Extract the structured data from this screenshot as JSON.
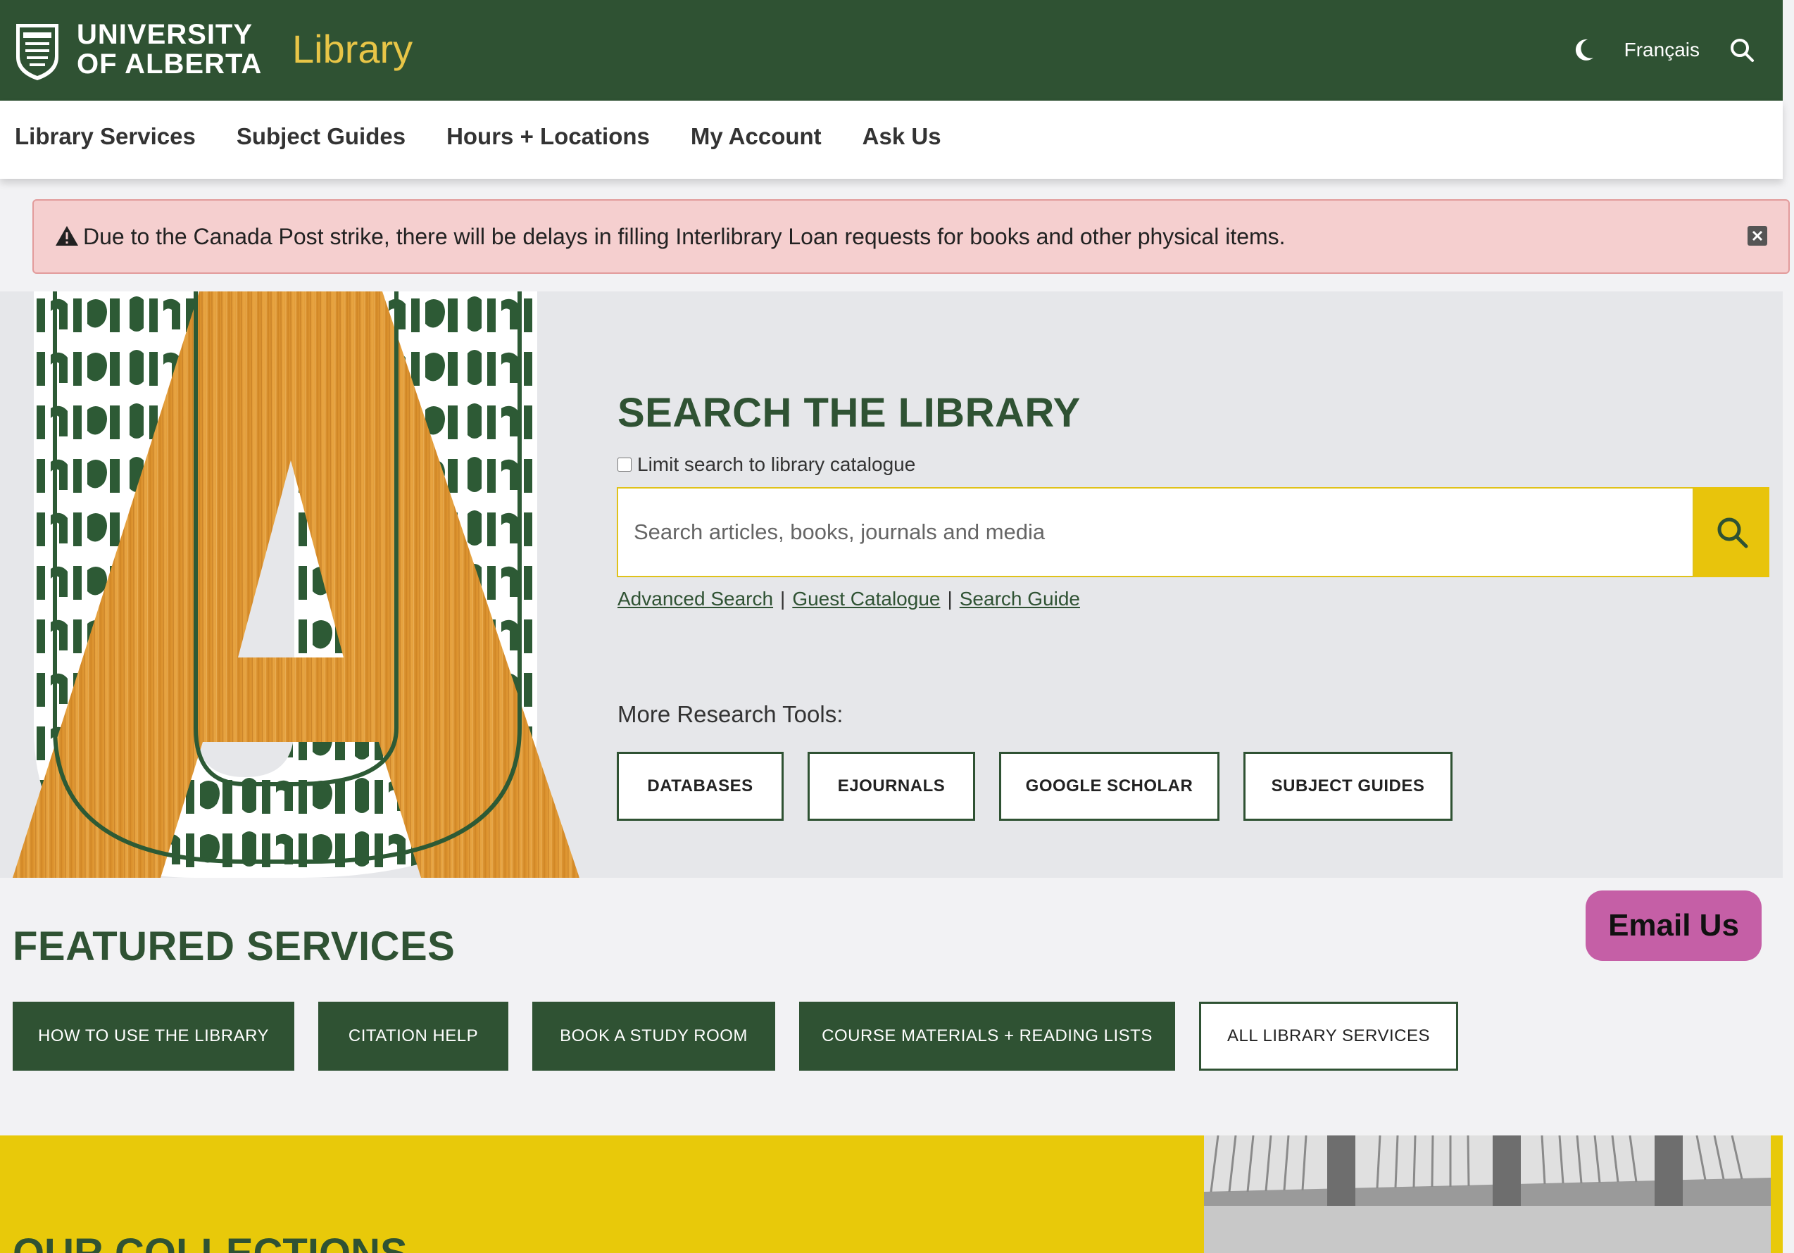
{
  "header": {
    "logo_line1": "UNIVERSITY",
    "logo_line2": "OF ALBERTA",
    "site_title": "Library",
    "language_link": "Français",
    "icons": [
      "moon-icon",
      "search-icon"
    ]
  },
  "nav": {
    "items": [
      "Library Services",
      "Subject Guides",
      "Hours + Locations",
      "My Account",
      "Ask Us"
    ]
  },
  "alert": {
    "text": "Due to the Canada Post strike, there will be delays in filling Interlibrary Loan requests for books and other physical items."
  },
  "search": {
    "title": "SEARCH THE LIBRARY",
    "limit_label": "Limit search to library catalogue",
    "placeholder": "Search articles, books, journals and media",
    "links": [
      "Advanced Search",
      "Guest Catalogue",
      "Search Guide"
    ],
    "separator": "|",
    "more_tools_label": "More Research Tools:",
    "tools": [
      "DATABASES",
      "EJOURNALS",
      "GOOGLE SCHOLAR",
      "SUBJECT GUIDES"
    ]
  },
  "featured": {
    "title": "FEATURED SERVICES",
    "buttons": [
      "HOW TO USE THE LIBRARY",
      "CITATION HELP",
      "BOOK A STUDY ROOM",
      "COURSE MATERIALS + READING LISTS"
    ],
    "all_services": "ALL LIBRARY SERVICES"
  },
  "email_button": "Email Us",
  "collections": {
    "title": "OUR COLLECTIONS"
  },
  "colors": {
    "brand_green": "#2f5233",
    "brand_gold": "#e8c547",
    "accent_yellow": "#e8c40c",
    "alert_bg": "#f5cfcf",
    "email_pink": "#c55fa6"
  }
}
